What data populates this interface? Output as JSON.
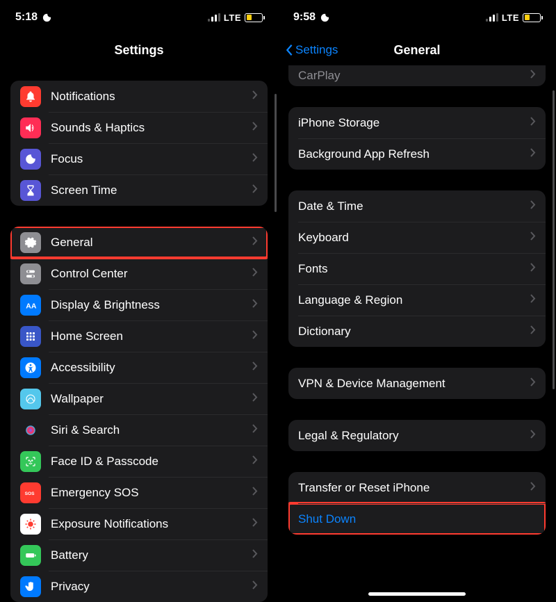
{
  "left": {
    "status": {
      "time": "5:18",
      "carrier": "LTE"
    },
    "title": "Settings",
    "group1": [
      {
        "label": "Notifications"
      },
      {
        "label": "Sounds & Haptics"
      },
      {
        "label": "Focus"
      },
      {
        "label": "Screen Time"
      }
    ],
    "group2": [
      {
        "label": "General"
      },
      {
        "label": "Control Center"
      },
      {
        "label": "Display & Brightness"
      },
      {
        "label": "Home Screen"
      },
      {
        "label": "Accessibility"
      },
      {
        "label": "Wallpaper"
      },
      {
        "label": "Siri & Search"
      },
      {
        "label": "Face ID & Passcode"
      },
      {
        "label": "Emergency SOS"
      },
      {
        "label": "Exposure Notifications"
      },
      {
        "label": "Battery"
      },
      {
        "label": "Privacy"
      }
    ]
  },
  "right": {
    "status": {
      "time": "9:58",
      "carrier": "LTE"
    },
    "back": "Settings",
    "title": "General",
    "carplay": "CarPlay",
    "group1": [
      {
        "label": "iPhone Storage"
      },
      {
        "label": "Background App Refresh"
      }
    ],
    "group2": [
      {
        "label": "Date & Time"
      },
      {
        "label": "Keyboard"
      },
      {
        "label": "Fonts"
      },
      {
        "label": "Language & Region"
      },
      {
        "label": "Dictionary"
      }
    ],
    "group3": [
      {
        "label": "VPN & Device Management"
      }
    ],
    "group4": [
      {
        "label": "Legal & Regulatory"
      }
    ],
    "group5": [
      {
        "label": "Transfer or Reset iPhone"
      },
      {
        "label": "Shut Down"
      }
    ]
  }
}
